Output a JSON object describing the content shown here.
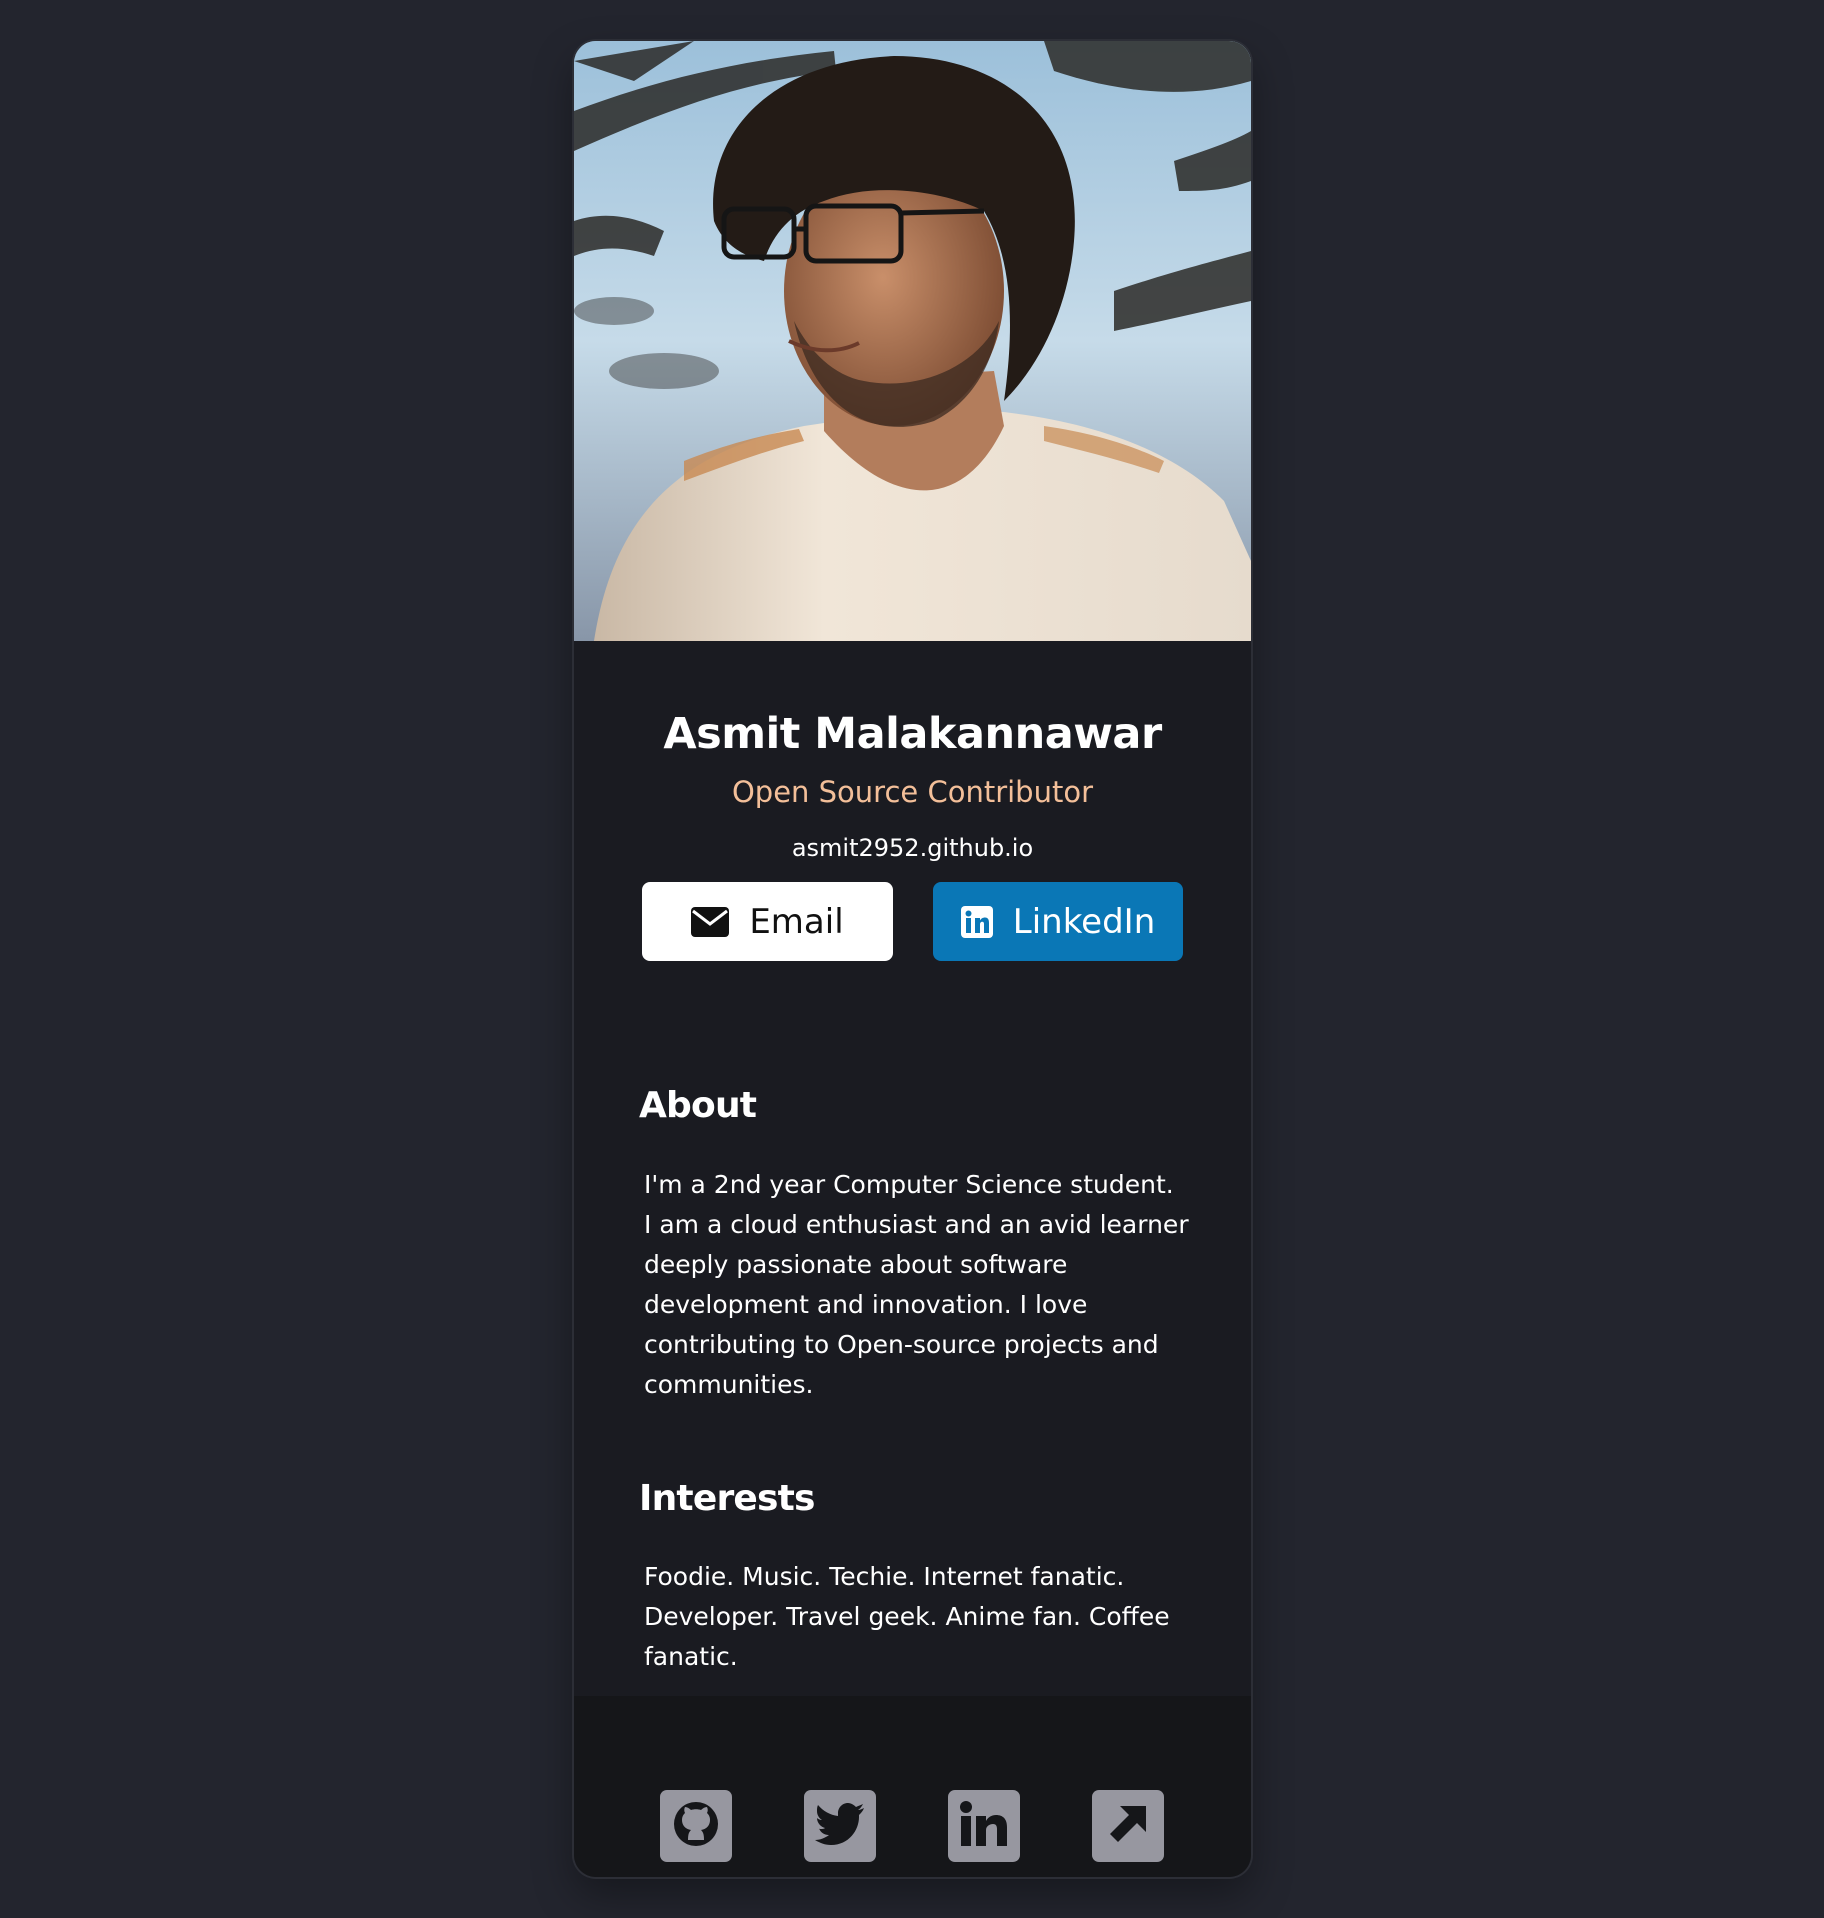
{
  "profile": {
    "name": "Asmit Malakannawar",
    "role": "Open Source Contributor",
    "website": "asmit2952.github.io",
    "role_color": "#f3bf99"
  },
  "buttons": {
    "email_label": "Email",
    "email_icon": "envelope-icon",
    "linkedin_label": "LinkedIn",
    "linkedin_icon": "linkedin-icon",
    "linkedin_color": "#0a77b6"
  },
  "about": {
    "heading": "About",
    "text": "I'm a 2nd year Computer Science student. I am a cloud enthusiast and an avid learner deeply passionate about software development and innovation. I love contributing to Open-source projects and communities."
  },
  "interests": {
    "heading": "Interests",
    "text": "Foodie. Music. Techie. Internet fanatic. Developer. Travel geek. Anime fan. Coffee fanatic."
  },
  "footer": {
    "icons": [
      "github-icon",
      "twitter-icon",
      "linkedin-icon",
      "external-link-icon"
    ]
  }
}
